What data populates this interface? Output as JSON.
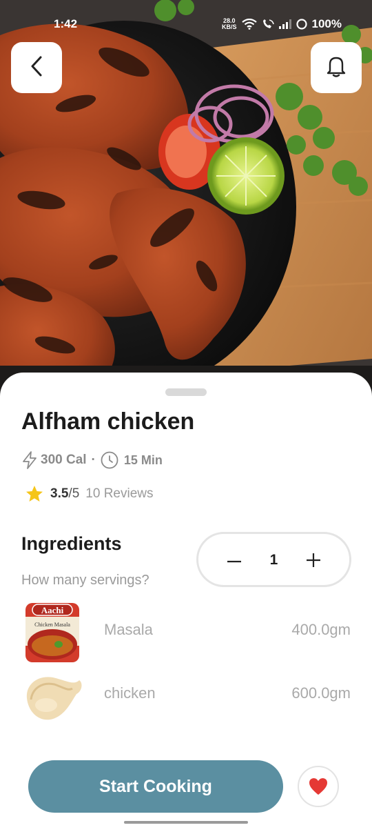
{
  "status_bar": {
    "time": "1:42",
    "net_speed_value": "28.0",
    "net_speed_unit": "KB/S",
    "battery": "100%"
  },
  "header": {
    "back_icon": "chevron-left-icon",
    "notification_icon": "bell-icon"
  },
  "recipe": {
    "title": "Alfham chicken",
    "calories": "300 Cal",
    "separator": "·",
    "duration": "15 Min",
    "rating_score": "3.5",
    "rating_max": "/5",
    "reviews": "10 Reviews"
  },
  "ingredients": {
    "heading": "Ingredients",
    "servings_label": "How many servings?",
    "servings_count": "1",
    "items": [
      {
        "name": "Masala",
        "quantity": "400.0gm",
        "image_brand": "Aachi",
        "image_caption": "Chicken Masala"
      },
      {
        "name": "chicken",
        "quantity": "600.0gm"
      }
    ]
  },
  "actions": {
    "start_label": "Start Cooking",
    "favorite_icon": "heart-icon"
  },
  "colors": {
    "primary": "#5b8fa1",
    "favorite": "#e53935",
    "star": "#f5c518"
  }
}
